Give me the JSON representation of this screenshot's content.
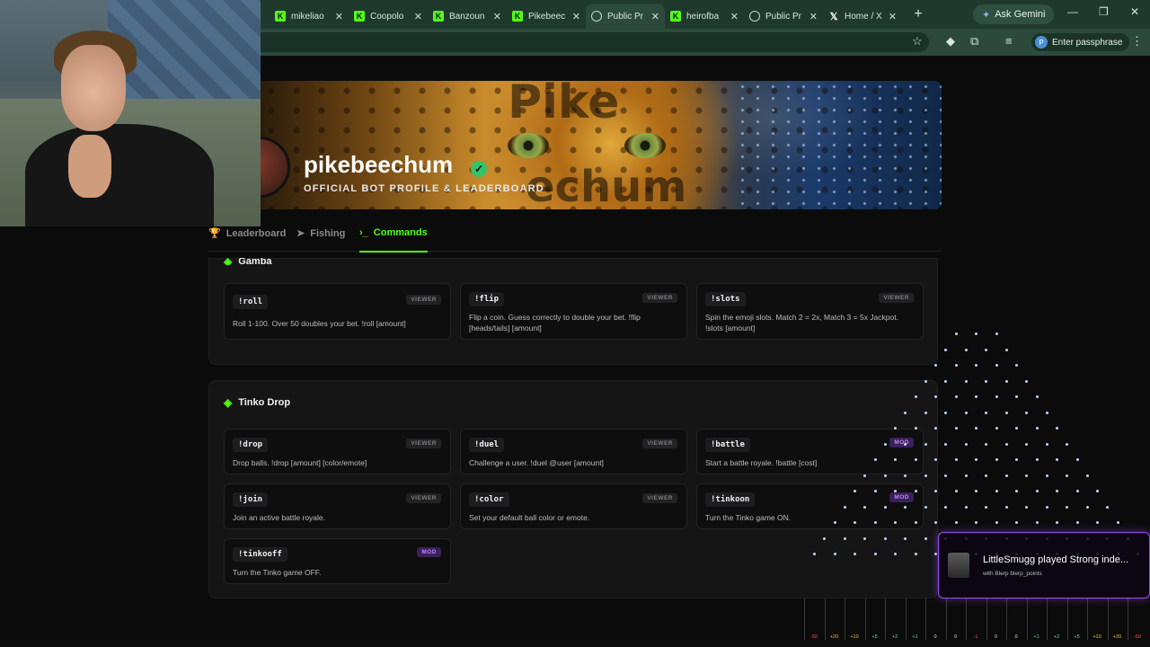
{
  "browser": {
    "tabs": [
      {
        "label": "mikeliao",
        "icon": "kick-icon"
      },
      {
        "label": "Coopolo",
        "icon": "kick-icon"
      },
      {
        "label": "Banzoun",
        "icon": "kick-icon"
      },
      {
        "label": "Pikebeec",
        "icon": "kick-icon"
      },
      {
        "label": "Public Pr",
        "icon": "globe-icon",
        "active": true
      },
      {
        "label": "heirofba",
        "icon": "kick-icon"
      },
      {
        "label": "Public Pr",
        "icon": "globe-icon"
      },
      {
        "label": "Home / X",
        "icon": "x-icon"
      }
    ],
    "gemini_label": "Ask Gemini",
    "url_fragment": "n",
    "passphrase_label": "Enter passphrase",
    "profile_initial": "P"
  },
  "profile": {
    "name": "pikebeechum",
    "subtitle": "OFFICIAL BOT PROFILE & LEADERBOARD",
    "banner_watermark_top": "Pike",
    "banner_watermark_bottom": "echum"
  },
  "nav": {
    "tabs": [
      {
        "label": "Leaderboard",
        "icon": "trophy-icon"
      },
      {
        "label": "Fishing",
        "icon": "fish-icon"
      },
      {
        "label": "Commands",
        "icon": "terminal-icon",
        "active": true
      }
    ]
  },
  "sections": [
    {
      "title": "Gamba",
      "commands": [
        {
          "cmd": "!roll",
          "role": "VIEWER",
          "desc": "Roll 1-100. Over 50 doubles your bet. !roll [amount]"
        },
        {
          "cmd": "!flip",
          "role": "VIEWER",
          "desc": "Flip a coin. Guess correctly to double your bet. !flip [heads/tails] [amount]"
        },
        {
          "cmd": "!slots",
          "role": "VIEWER",
          "desc": "Spin the emoji slots. Match 2 = 2x, Match 3 = 5x Jackpot. !slots [amount]"
        }
      ]
    },
    {
      "title": "Tinko Drop",
      "commands": [
        {
          "cmd": "!drop",
          "role": "VIEWER",
          "desc": "Drop balls. !drop [amount] [color/emote]"
        },
        {
          "cmd": "!duel",
          "role": "VIEWER",
          "desc": "Challenge a user. !duel @user [amount]"
        },
        {
          "cmd": "!battle",
          "role": "MOD",
          "desc": "Start a battle royale. !battle [cost]"
        },
        {
          "cmd": "!join",
          "role": "VIEWER",
          "desc": "Join an active battle royale."
        },
        {
          "cmd": "!color",
          "role": "VIEWER",
          "desc": "Set your default ball color or emote."
        },
        {
          "cmd": "!tinkoon",
          "role": "MOD",
          "desc": "Turn the Tinko game ON."
        },
        {
          "cmd": "!tinkooff",
          "role": "MOD",
          "desc": "Turn the Tinko game OFF."
        }
      ]
    }
  ],
  "overlay": {
    "alert_title": "LittleSmugg played Strong inde...",
    "alert_subtitle": "with Blerp blerp_points",
    "slot_values": [
      "-50",
      "+20",
      "+10",
      "+5",
      "+2",
      "+1",
      "0",
      "0",
      "-1",
      "0",
      "0",
      "+1",
      "+2",
      "+5",
      "+10",
      "+20",
      "-50"
    ]
  },
  "colors": {
    "accent": "#53fc18",
    "mod_badge": "#3a1f5a",
    "alert_border": "#9b4df0"
  }
}
